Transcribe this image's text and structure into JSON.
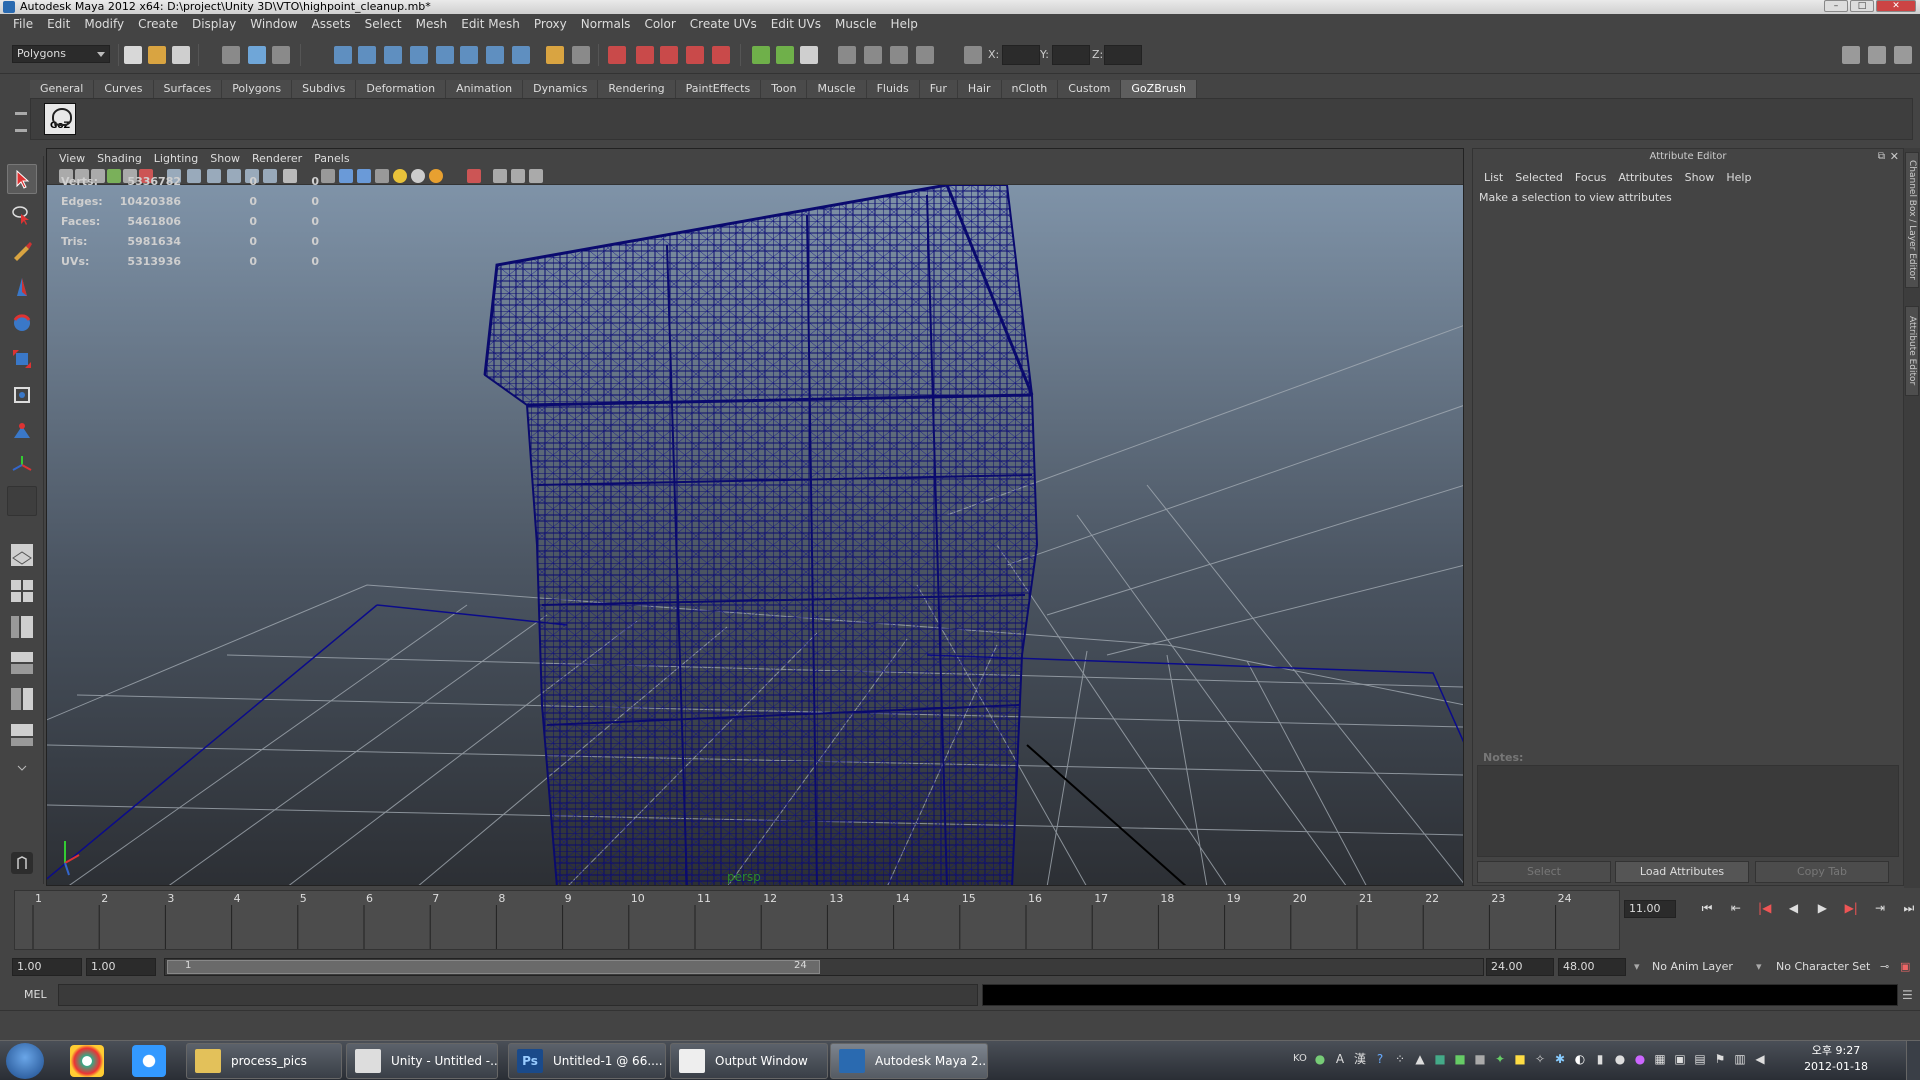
{
  "window": {
    "title": "Autodesk Maya 2012 x64: D:\\project\\Unity 3D\\VTO\\highpoint_cleanup.mb*"
  },
  "menubar": [
    "File",
    "Edit",
    "Modify",
    "Create",
    "Display",
    "Window",
    "Assets",
    "Select",
    "Mesh",
    "Edit Mesh",
    "Proxy",
    "Normals",
    "Color",
    "Create UVs",
    "Edit UVs",
    "Muscle",
    "Help"
  ],
  "statusline": {
    "mode": "Polygons",
    "x_label": "X:",
    "y_label": "Y:",
    "z_label": "Z:"
  },
  "shelf": {
    "tabs": [
      "General",
      "Curves",
      "Surfaces",
      "Polygons",
      "Subdivs",
      "Deformation",
      "Animation",
      "Dynamics",
      "Rendering",
      "PaintEffects",
      "Toon",
      "Muscle",
      "Fluids",
      "Fur",
      "Hair",
      "nCloth",
      "Custom",
      "GoZBrush"
    ],
    "active_tab": "GoZBrush",
    "goz_label": "GoZ"
  },
  "viewport": {
    "menu": [
      "View",
      "Shading",
      "Lighting",
      "Show",
      "Renderer",
      "Panels"
    ],
    "camera": "persp",
    "hud": [
      {
        "label": "Verts:",
        "a": "5336782",
        "b": "0",
        "c": "0"
      },
      {
        "label": "Edges:",
        "a": "10420386",
        "b": "0",
        "c": "0"
      },
      {
        "label": "Faces:",
        "a": "5461806",
        "b": "0",
        "c": "0"
      },
      {
        "label": "Tris:",
        "a": "5981634",
        "b": "0",
        "c": "0"
      },
      {
        "label": "UVs:",
        "a": "5313936",
        "b": "0",
        "c": "0"
      }
    ],
    "wire_color": "#0a0a6e"
  },
  "attribute_editor": {
    "title": "Attribute Editor",
    "menu": [
      "List",
      "Selected",
      "Focus",
      "Attributes",
      "Show",
      "Help"
    ],
    "message": "Make a selection to view attributes",
    "notes_label": "Notes:",
    "buttons": {
      "select": "Select",
      "load": "Load Attributes",
      "copy": "Copy Tab"
    },
    "side_tabs": [
      "Channel Box / Layer Editor",
      "Attribute Editor"
    ]
  },
  "timeslider": {
    "ticks": [
      "1",
      "2",
      "3",
      "4",
      "5",
      "6",
      "7",
      "8",
      "9",
      "10",
      "11",
      "12",
      "13",
      "14",
      "15",
      "16",
      "17",
      "18",
      "19",
      "20",
      "21",
      "22",
      "23",
      "24"
    ],
    "current_time": "11.00"
  },
  "range": {
    "start_time": "1.00",
    "playback_start": "1.00",
    "range_start": "1",
    "range_end": "24",
    "playback_end": "24.00",
    "end_time": "48.00",
    "anim_layer": "No Anim Layer",
    "character_set": "No Character Set"
  },
  "cmdline": {
    "label": "MEL"
  },
  "taskbar": {
    "tasks": [
      {
        "label": "process_pics",
        "icon": "folder-icon"
      },
      {
        "label": "Unity - Untitled -...",
        "icon": "unity-icon"
      },
      {
        "label": "Untitled-1 @ 66....",
        "icon": "photoshop-icon"
      },
      {
        "label": "Output Window",
        "icon": "window-icon"
      },
      {
        "label": "Autodesk Maya 2...",
        "icon": "maya-icon"
      }
    ],
    "tray": {
      "lang": "KO",
      "ime_a": "A",
      "ime_han": "漢"
    },
    "clock": {
      "time": "오후 9:27",
      "date": "2012-01-18"
    }
  }
}
